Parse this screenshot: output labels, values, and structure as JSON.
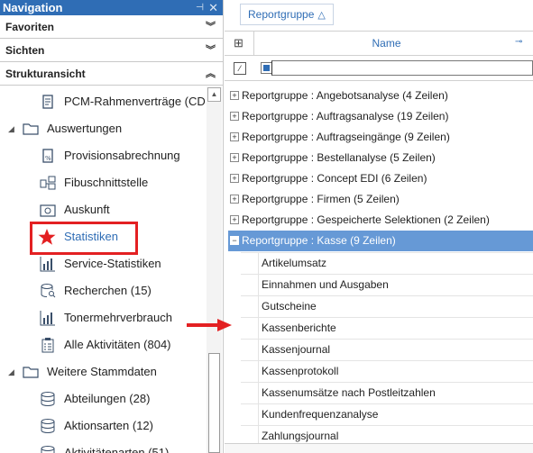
{
  "nav": {
    "title": "Navigation",
    "sections": [
      "Favoriten",
      "Sichten",
      "Strukturansicht"
    ],
    "tree": [
      {
        "label": "PCM-Rahmenverträge (CD",
        "icon": "contract-icon"
      },
      {
        "label": "Auswertungen",
        "icon": "folder-icon"
      },
      {
        "label": "Provisionsabrechnung",
        "icon": "percent-document-icon"
      },
      {
        "label": "Fibuschnittstelle",
        "icon": "accounting-interface-icon"
      },
      {
        "label": "Auskunft",
        "icon": "camera-icon"
      },
      {
        "label": "Statistiken",
        "icon": "star-icon"
      },
      {
        "label": "Service-Statistiken",
        "icon": "bar-chart-icon"
      },
      {
        "label": "Recherchen (15)",
        "icon": "database-search-icon"
      },
      {
        "label": "Tonermehrverbrauch",
        "icon": "bar-chart-icon"
      },
      {
        "label": "Alle Aktivitäten (804)",
        "icon": "clipboard-icon"
      },
      {
        "label": "Weitere Stammdaten",
        "icon": "folder-icon"
      },
      {
        "label": "Abteilungen (28)",
        "icon": "database-icon"
      },
      {
        "label": "Aktionsarten (12)",
        "icon": "database-icon"
      },
      {
        "label": "Aktivitätenarten (51)",
        "icon": "database-icon"
      }
    ]
  },
  "grid": {
    "group_chip": "Reportgruppe",
    "column_name": "Name",
    "groups": [
      "Reportgruppe : Angebotsanalyse (4 Zeilen)",
      "Reportgruppe : Auftragsanalyse (19 Zeilen)",
      "Reportgruppe : Auftragseingänge (9 Zeilen)",
      "Reportgruppe : Bestellanalyse (5 Zeilen)",
      "Reportgruppe : Concept EDI (6 Zeilen)",
      "Reportgruppe : Firmen (5 Zeilen)",
      "Reportgruppe : Gespeicherte Selektionen (2 Zeilen)",
      "Reportgruppe : Kasse (9 Zeilen)"
    ],
    "rows": [
      "Artikelumsatz",
      "Einnahmen und Ausgaben",
      "Gutscheine",
      "Kassenberichte",
      "Kassenjournal",
      "Kassenprotokoll",
      "Kassenumsätze nach Postleitzahlen",
      "Kundenfrequenzanalyse",
      "Zahlungsjournal"
    ]
  },
  "colors": {
    "accent": "#2f6db5",
    "selection": "#6699d6",
    "highlight": "#e32022"
  }
}
